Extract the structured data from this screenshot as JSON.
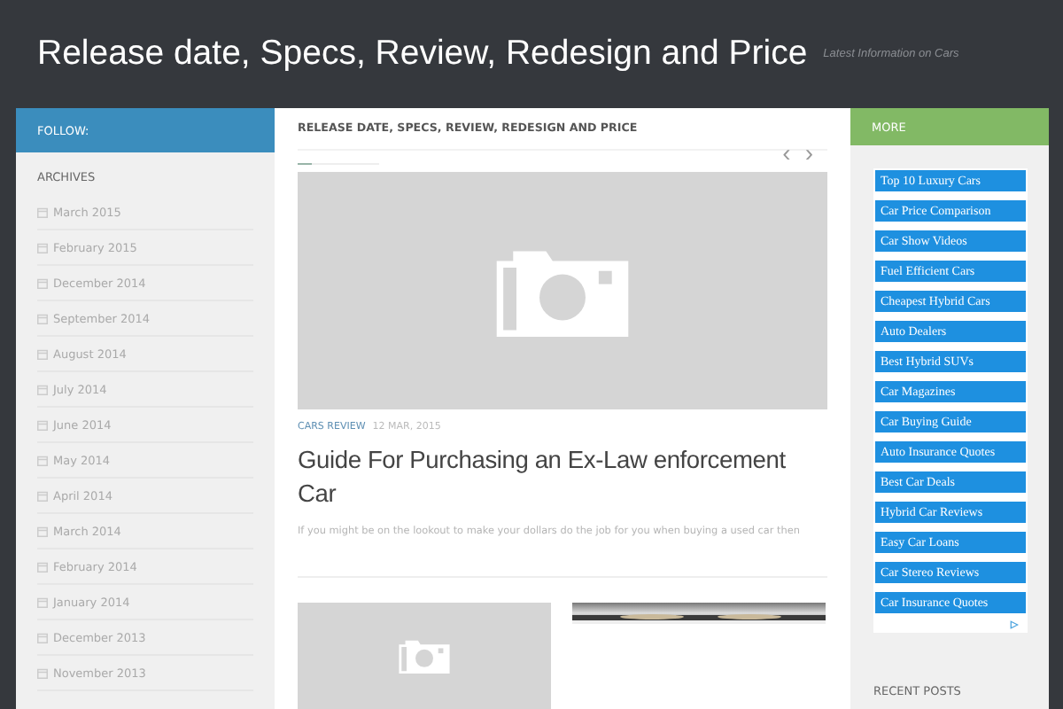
{
  "site": {
    "title": "Release date, Specs, Review, Redesign and Price",
    "tagline": "Latest Information on Cars"
  },
  "left_sidebar": {
    "header": "FOLLOW:",
    "archives_title": "ARCHIVES",
    "archives": [
      "March 2015",
      "February 2015",
      "December 2014",
      "September 2014",
      "August 2014",
      "July 2014",
      "June 2014",
      "May 2014",
      "April 2014",
      "March 2014",
      "February 2014",
      "January 2014",
      "December 2013",
      "November 2013"
    ]
  },
  "main": {
    "header": "RELEASE DATE, SPECS, REVIEW, REDESIGN AND PRICE",
    "slider_nav": [
      "‹",
      "›"
    ],
    "slides": [
      {
        "selected": true
      },
      {
        "selected": false
      }
    ],
    "post": {
      "category": "CARS REVIEW",
      "date": "12 MAR, 2015",
      "title": "Guide For Purchasing an Ex-Law enforcement Car",
      "excerpt": "If you might be on the lookout to make your dollars do the job for you when buying a used car then"
    }
  },
  "right_sidebar": {
    "header": "MORE",
    "links": [
      "Top 10 Luxury Cars",
      "Car Price Comparison",
      "Car Show Videos",
      "Fuel Efficient Cars",
      "Cheapest Hybrid Cars",
      "Auto Dealers",
      "Best Hybrid SUVs",
      "Car Magazines",
      "Car Buying Guide",
      "Auto Insurance Quotes",
      "Best Car Deals",
      "Hybrid Car Reviews",
      "Easy Car Loans",
      "Car Stereo Reviews",
      "Car Insurance Quotes"
    ],
    "recent_title": "RECENT POSTS"
  }
}
